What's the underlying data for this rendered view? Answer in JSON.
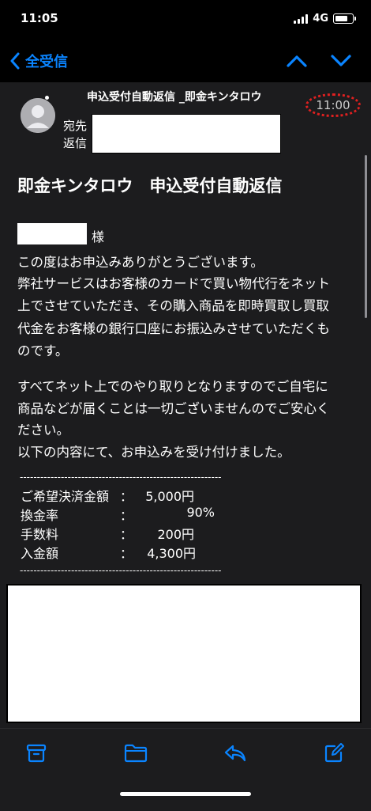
{
  "status": {
    "time": "11:05",
    "network": "4G"
  },
  "nav": {
    "back_label": "全受信"
  },
  "header": {
    "subject": "申込受付自動返信 _即金キンタロウ",
    "to_label": "宛先",
    "reply_label": "返信",
    "time": "11:00"
  },
  "body": {
    "title": "即金キンタロウ　申込受付自動返信",
    "salutation": "様",
    "para1": [
      "この度はお申込みありがとうございます。",
      "弊社サービスはお客様のカードで買い物代行をネット",
      "上でさせていただき、その購入商品を即時買取し買取",
      "代金をお客様の銀行口座にお振込みさせていただくも",
      "のです。"
    ],
    "para2": [
      "すべてネット上でのやり取りとなりますのでご自宅に",
      "商品などが届くことは一切ございませんのでご安心く",
      "ださい。",
      "以下の内容にて、お申込みを受け付けました。"
    ],
    "divider": "-----------------------------------------------------------",
    "table": [
      {
        "key": "ご希望決済金額",
        "value": "5,000円"
      },
      {
        "key": "換金率",
        "value": "90%"
      },
      {
        "key": "手数料",
        "value": "200円"
      },
      {
        "key": "入金額",
        "value": "4,300円"
      }
    ],
    "colon": "："
  },
  "toolbar": {
    "icons": [
      "archive-icon",
      "folder-icon",
      "reply-icon",
      "compose-icon"
    ]
  },
  "colors": {
    "accent": "#0a84ff",
    "background": "#1c1c1e",
    "highlight": "#e02020"
  }
}
